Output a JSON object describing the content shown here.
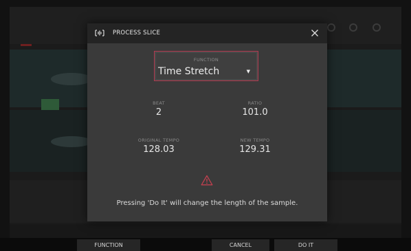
{
  "dialog": {
    "title": "PROCESS SLICE",
    "function": {
      "label": "FUNCTION",
      "value": "Time Stretch"
    },
    "beat": {
      "label": "BEAT",
      "value": "2"
    },
    "ratio": {
      "label": "RATIO",
      "value": "101.0"
    },
    "original_tempo": {
      "label": "ORIGINAL TEMPO",
      "value": "128.03"
    },
    "new_tempo": {
      "label": "NEW TEMPO",
      "value": "129.31"
    },
    "warning": "Pressing 'Do It' will change the length of the sample."
  },
  "footer": {
    "function_label": "FUNCTION",
    "cancel_label": "CANCEL",
    "doit_label": "DO IT"
  },
  "colors": {
    "accent": "#b2394f",
    "warning": "#c0404f",
    "dialog_bg": "#3a3a3a",
    "header_bg": "#242424"
  },
  "icons": [
    "waveform-icon",
    "close-icon",
    "warning-icon",
    "dropdown-caret-icon"
  ]
}
